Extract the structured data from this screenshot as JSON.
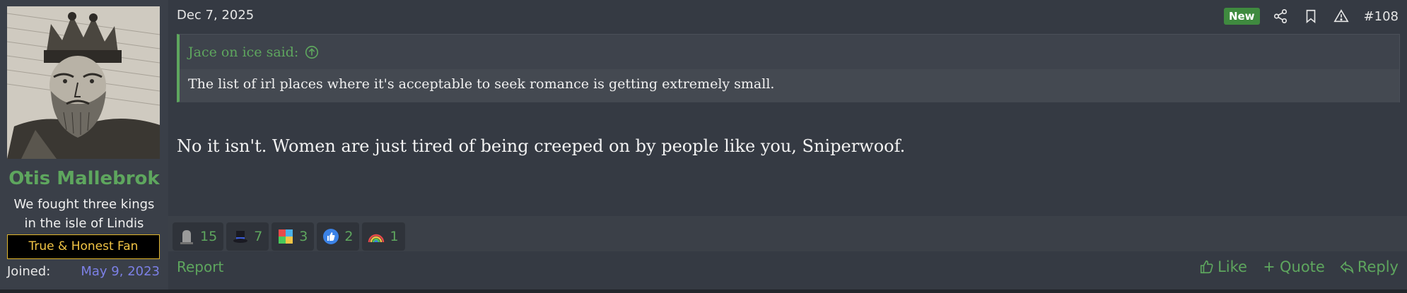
{
  "post": {
    "date": "Dec 7, 2025",
    "badge": "New",
    "number": "#108",
    "header_icons": [
      "share-icon",
      "bookmark-icon",
      "report-warning-icon"
    ]
  },
  "user": {
    "name": "Otis Mallebrok",
    "title_line1": "We fought three kings",
    "title_line2": "in the isle of Lindis",
    "banner": "True & Honest Fan",
    "joined_label": "Joined:",
    "joined_value": "May 9, 2023",
    "avatar": "king-portrait-engraving"
  },
  "quote": {
    "author": "Jace on ice said:",
    "text": "The list of irl places where it's acceptable to seek romance is getting extremely small."
  },
  "message": "No it isn't. Women are just tired of being creeped on by people like you, Sniperwoof.",
  "reactions": [
    {
      "icon": "tombstone-icon",
      "count": "15"
    },
    {
      "icon": "top-hat-icon",
      "count": "7"
    },
    {
      "icon": "puzzle-pieces-icon",
      "count": "3"
    },
    {
      "icon": "thumbs-up-icon",
      "count": "2"
    },
    {
      "icon": "rainbow-icon",
      "count": "1"
    }
  ],
  "footer": {
    "report": "Report",
    "like": "Like",
    "quote": "Quote",
    "reply": "Reply"
  },
  "colors": {
    "accent_green": "#5ea65e",
    "link_purple": "#7c80e6",
    "banner_gold": "#f2c545",
    "background": "#353a43"
  }
}
